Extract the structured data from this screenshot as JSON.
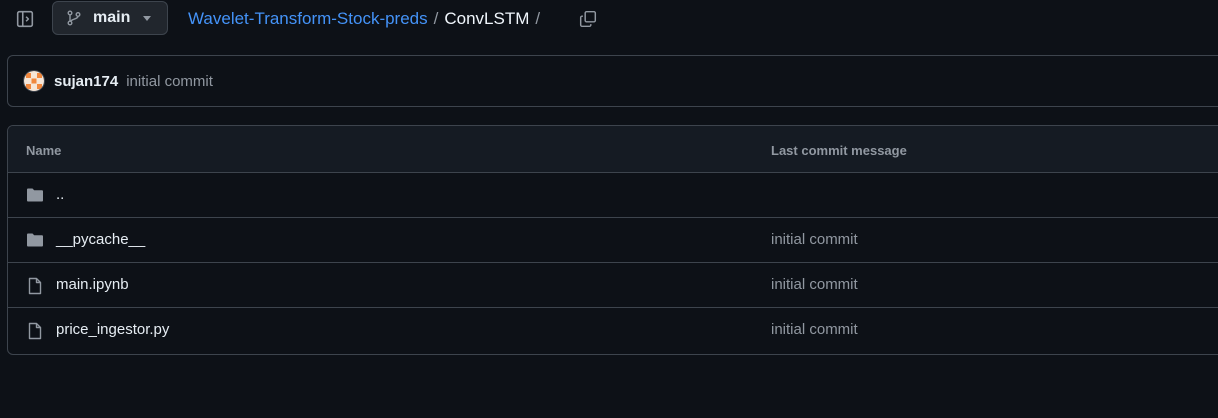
{
  "header": {
    "branch": "main",
    "breadcrumb": {
      "repo": "Wavelet-Transform-Stock-preds",
      "separator": "/",
      "directory": "ConvLSTM",
      "trailing_separator": "/"
    },
    "icons": {
      "sidebar_toggle": "sidebar-collapse-icon",
      "branch": "git-branch-icon",
      "copy": "copy-icon"
    }
  },
  "latest_commit": {
    "author": "sujan174",
    "message": "initial commit",
    "avatar_icon": "identicon-avatar"
  },
  "file_table": {
    "columns": [
      "Name",
      "Last commit message"
    ],
    "rows": [
      {
        "name": "..",
        "type": "directory",
        "message": ""
      },
      {
        "name": "__pycache__",
        "type": "directory",
        "message": "initial commit"
      },
      {
        "name": "main.ipynb",
        "type": "file",
        "message": "initial commit"
      },
      {
        "name": "price_ingestor.py",
        "type": "file",
        "message": "initial commit"
      }
    ]
  },
  "colors": {
    "background": "#0d1117",
    "link": "#4493f8",
    "muted_text": "#9198a1",
    "border": "#3d444d",
    "header_bg": "#151b23",
    "avatar_accent": "#f0883e"
  }
}
